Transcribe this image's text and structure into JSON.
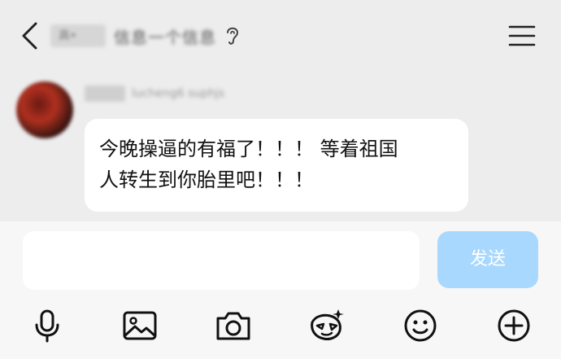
{
  "header": {
    "back_icon": "chevron-left-icon",
    "chip_text": "高•",
    "title": "信息一个信息",
    "hearing_icon": "ear-icon",
    "menu_icon": "hamburger-menu-icon"
  },
  "message": {
    "sender_name": "lucheng6 suphjs",
    "text_line1": "今晚操逼的有福了！！！ 等着祖国",
    "text_line2": "人转生到你胎里吧！！！"
  },
  "composer": {
    "input_value": "",
    "send_label": "发送",
    "send_color": "#a9d8ff"
  },
  "toolbar": {
    "icons": [
      "microphone-icon",
      "image-icon",
      "camera-icon",
      "sticker-icon",
      "emoji-icon",
      "plus-circle-icon"
    ]
  }
}
